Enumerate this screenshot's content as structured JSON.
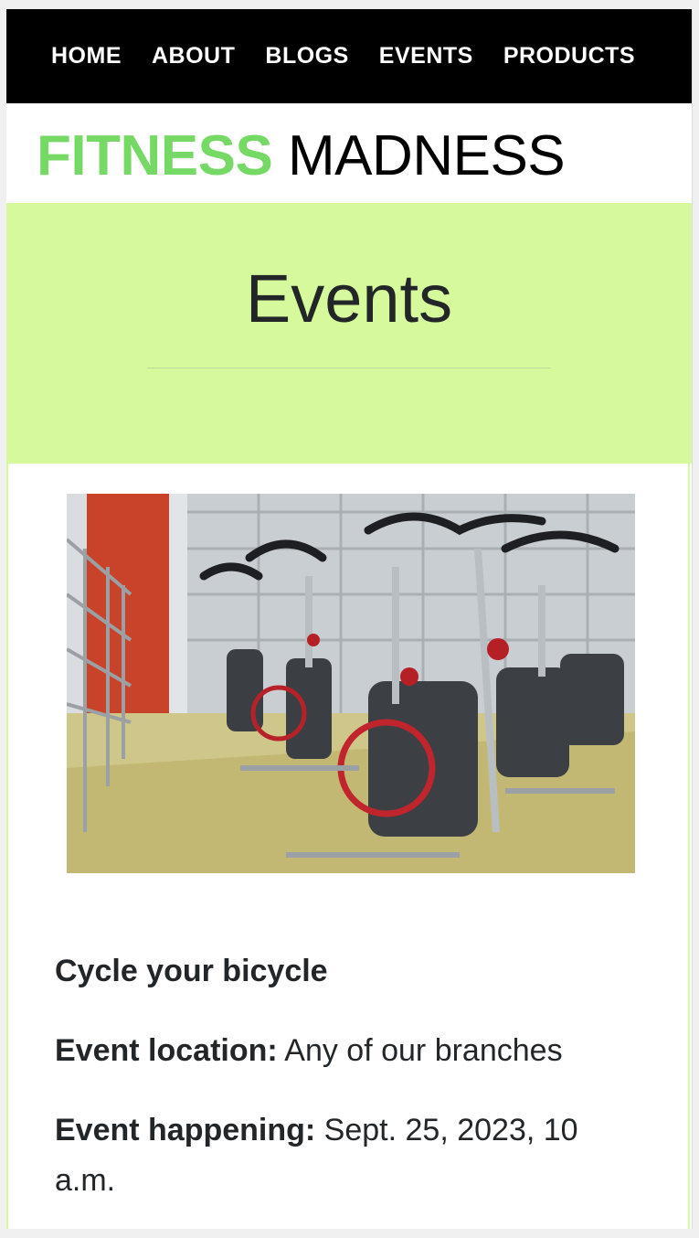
{
  "nav": {
    "items": [
      {
        "label": "HOME"
      },
      {
        "label": "ABOUT"
      },
      {
        "label": "BLOGS"
      },
      {
        "label": "EVENTS"
      },
      {
        "label": "PRODUCTS"
      }
    ]
  },
  "brand": {
    "part1": "FITNESS",
    "part2": " MADNESS",
    "accent_color": "#76d966"
  },
  "hero": {
    "title": "Events",
    "background_color": "#d6fa9b"
  },
  "event": {
    "image_icon": "spin-bikes-photo",
    "title": "Cycle your bicycle",
    "location_label": "Event location:",
    "location_value": " Any of our branches",
    "time_label": "Event happening:",
    "time_value": " Sept. 25, 2023, 10 a.m."
  }
}
